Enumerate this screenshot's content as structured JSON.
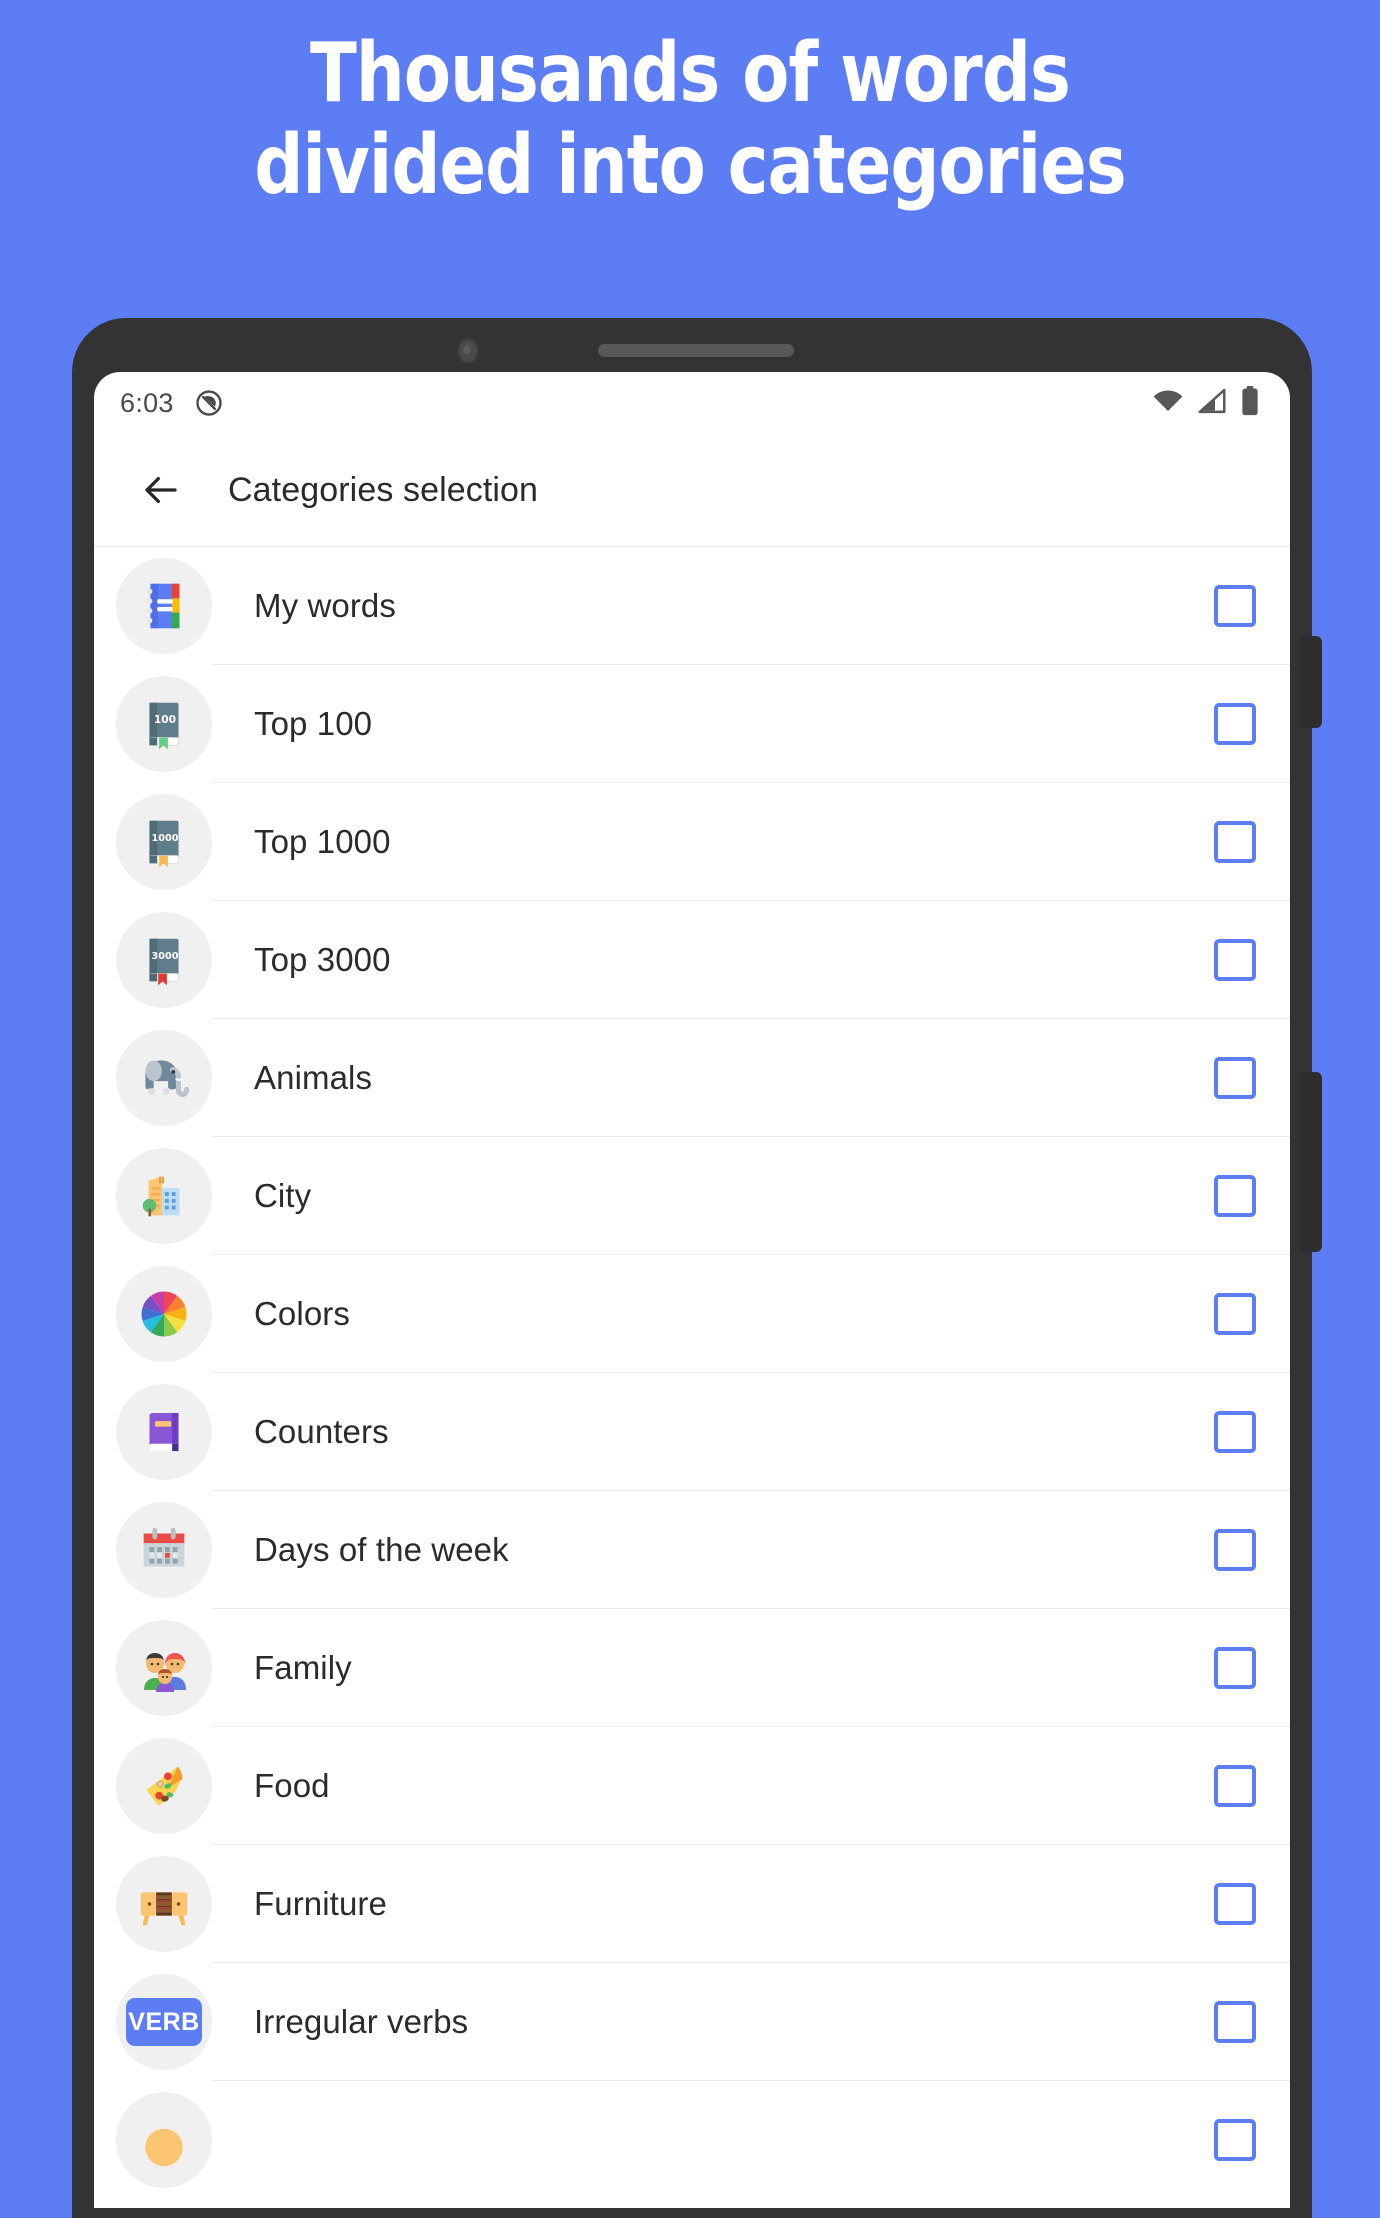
{
  "promo": {
    "headline_line1": "Thousands of words",
    "headline_line2": "divided into categories",
    "background_color": "#5d7df5",
    "headline_color": "#ffffff"
  },
  "status_bar": {
    "time": "6:03",
    "icons": [
      "do-not-disturb-icon",
      "wifi-icon",
      "cellular-signal-icon",
      "battery-icon"
    ]
  },
  "app_bar": {
    "back_label": "back-arrow-icon",
    "title": "Categories selection"
  },
  "theme": {
    "accent": "#5d7df5",
    "checkbox_border": "#5d7df5",
    "divider": "#ededed",
    "avatar_bg": "#f0f0f0",
    "text": "#2b2b2b"
  },
  "list": {
    "items": [
      {
        "label": "My words",
        "icon": "notebook-icon",
        "checked": false
      },
      {
        "label": "Top 100",
        "icon": "book-100-icon",
        "checked": false
      },
      {
        "label": "Top 1000",
        "icon": "book-1000-icon",
        "checked": false
      },
      {
        "label": "Top 3000",
        "icon": "book-3000-icon",
        "checked": false
      },
      {
        "label": "Animals",
        "icon": "elephant-icon",
        "checked": false
      },
      {
        "label": "City",
        "icon": "cityscape-icon",
        "checked": false
      },
      {
        "label": "Colors",
        "icon": "color-wheel-icon",
        "checked": false
      },
      {
        "label": "Counters",
        "icon": "purple-book-icon",
        "checked": false
      },
      {
        "label": "Days of the week",
        "icon": "calendar-icon",
        "checked": false
      },
      {
        "label": "Family",
        "icon": "family-icon",
        "checked": false
      },
      {
        "label": "Food",
        "icon": "pizza-icon",
        "checked": false
      },
      {
        "label": "Furniture",
        "icon": "dresser-icon",
        "checked": false
      },
      {
        "label": "Irregular verbs",
        "icon": "verb-badge-icon",
        "checked": false,
        "badge_text": "VERB"
      }
    ],
    "book_labels": {
      "top100": "100",
      "top1000": "1000",
      "top3000": "3000"
    }
  }
}
